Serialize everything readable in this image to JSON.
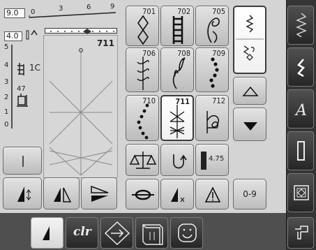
{
  "width_scale": {
    "value": "9.0",
    "ticks": [
      "0",
      "3",
      "6",
      "9"
    ]
  },
  "length_scale": {
    "value": "4.0",
    "ticks": [
      "5",
      "4",
      "3",
      "2",
      "1",
      "0"
    ]
  },
  "preview": {
    "stitch_number": "711"
  },
  "tension_labels": {
    "presser_foot": "1C",
    "feed_dog": "47"
  },
  "stitch_grid": [
    {
      "number": "701",
      "icon": "diamond-chain-icon",
      "selected": false
    },
    {
      "number": "702",
      "icon": "ladder-icon",
      "selected": false
    },
    {
      "number": "705",
      "icon": "paisley-icon",
      "selected": false
    },
    {
      "number": "706",
      "icon": "ornamental-vine-icon",
      "selected": false
    },
    {
      "number": "708",
      "icon": "leaf-sprig-icon",
      "selected": false
    },
    {
      "number": "709",
      "icon": "wave-dots-icon",
      "selected": false
    },
    {
      "number": "710",
      "icon": "diagonal-dots-icon",
      "selected": false
    },
    {
      "number": "711",
      "icon": "star-stitch-icon",
      "selected": true
    },
    {
      "number": "712",
      "icon": "loop-motif-icon",
      "selected": false
    }
  ],
  "scroll": {
    "up_arrow": "up",
    "down_arrow": "down"
  },
  "balance_value": "4.75",
  "numeric_entry_label": "0-9",
  "bottom_bar": {
    "clr_label": "clr"
  },
  "colors": {
    "accent_selected": "#ffffff",
    "background": "#4f4f4f",
    "panel": "#d4d4d4"
  }
}
